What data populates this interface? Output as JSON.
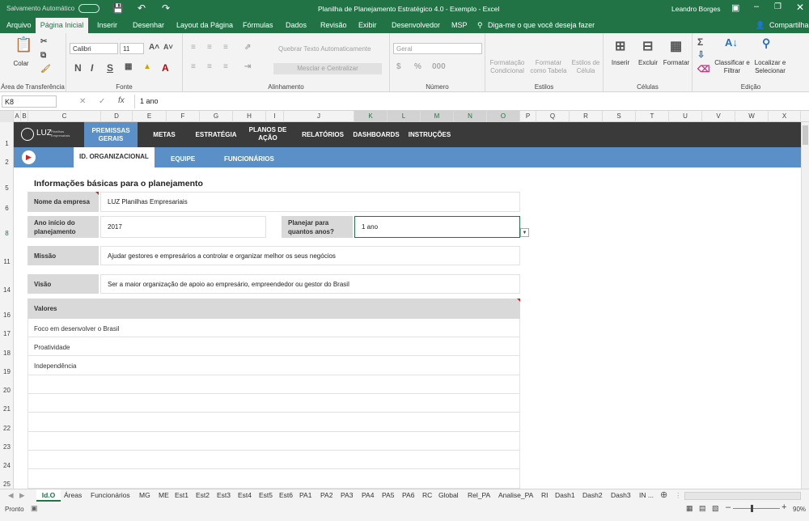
{
  "title": {
    "autosave": "Salvamento Automático",
    "doc": "Planilha de Planejamento Estratégico 4.0 - Exemplo  -  Excel",
    "user": "Leandro Borges"
  },
  "menu": [
    "Arquivo",
    "Página Inicial",
    "Inserir",
    "Desenhar",
    "Layout da Página",
    "Fórmulas",
    "Dados",
    "Revisão",
    "Exibir",
    "Desenvolvedor",
    "MSP"
  ],
  "tell_me": "Diga-me o que você deseja fazer",
  "share": "Compartilhar",
  "ribbon": {
    "paste": "Colar",
    "clipboard": "Área de Transferência",
    "font_name": "Calibri",
    "font_size": "11",
    "font_group": "Fonte",
    "wrap": "Quebrar Texto Automaticamente",
    "merge": "Mesclar e Centralizar",
    "align_group": "Alinhamento",
    "number_format": "Geral",
    "number_group": "Número",
    "cond_format": "Formatação Condicional",
    "format_table": "Formatar como Tabela",
    "cell_styles": "Estilos de Célula",
    "styles_group": "Estilos",
    "insert": "Inserir",
    "delete": "Excluir",
    "format": "Formatar",
    "cells_group": "Células",
    "sort": "Classificar e Filtrar",
    "find": "Localizar e Selecionar",
    "edit_group": "Edição"
  },
  "formula": {
    "namebox": "K8",
    "value": "1 ano"
  },
  "columns": [
    "A",
    "B",
    "C",
    "D",
    "E",
    "F",
    "G",
    "H",
    "I",
    "J",
    "K",
    "L",
    "M",
    "N",
    "O",
    "P",
    "Q",
    "R",
    "S",
    "T",
    "U",
    "V",
    "W",
    "X"
  ],
  "rows": [
    "1",
    "2",
    "5",
    "6",
    "8",
    "11",
    "14",
    "16",
    "17",
    "18",
    "19",
    "20",
    "21",
    "22",
    "23",
    "24",
    "25"
  ],
  "nav": {
    "logo": "LUZ",
    "logo_sub": "Planilhas Empresariais",
    "items": [
      "PREMISSAS GERAIS",
      "METAS",
      "ESTRATÉGIA",
      "PLANOS DE AÇÃO",
      "RELATÓRIOS",
      "DASHBOARDS",
      "INSTRUÇÕES"
    ],
    "subtabs": [
      "ID. ORGANIZACIONAL",
      "EQUIPE",
      "FUNCIONÁRIOS"
    ]
  },
  "form": {
    "heading": "Informações básicas para o planejamento",
    "company_label": "Nome da empresa",
    "company_value": "LUZ Planilhas Empresariais",
    "year_label": "Ano início do planejamento",
    "year_value": "2017",
    "horizon_label": "Planejar para quantos anos?",
    "horizon_value": "1 ano",
    "mission_label": "Missão",
    "mission_value": "Ajudar gestores e empresários a controlar e organizar melhor os seus negócios",
    "vision_label": "Visão",
    "vision_value": "Ser a maior organização de apoio ao empresário, empreendedor ou gestor do Brasil",
    "values_label": "Valores",
    "values": [
      "Foco em desenvolver o Brasil",
      "Proatividade",
      "Independência"
    ]
  },
  "sheets": [
    "Id.O",
    "Áreas",
    "Funcionários",
    "MG",
    "ME",
    "Est1",
    "Est2",
    "Est3",
    "Est4",
    "Est5",
    "Est6",
    "PA1",
    "PA2",
    "PA3",
    "PA4",
    "PA5",
    "PA6",
    "RC",
    "Global",
    "Rel_PA",
    "Analise_PA",
    "RI",
    "Dash1",
    "Dash2",
    "Dash3",
    "IN ..."
  ],
  "status": {
    "ready": "Pronto",
    "zoom": "90%"
  }
}
